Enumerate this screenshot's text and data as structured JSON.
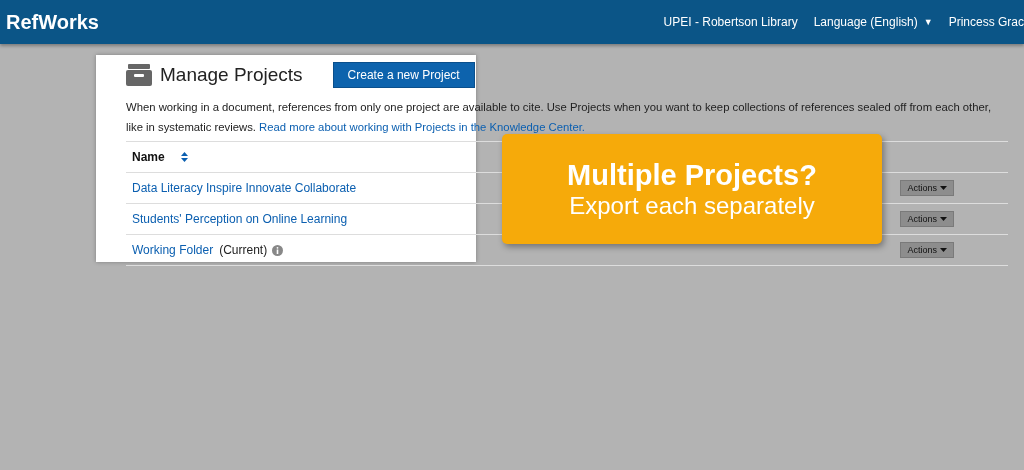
{
  "header": {
    "logo": "RefWorks",
    "institution": "UPEI - Robertson Library",
    "language": "Language (English)",
    "language_caret": "▼",
    "user": "Princess Grac"
  },
  "page": {
    "title": "Manage Projects",
    "create_button": "Create a new Project",
    "description": "When working in a document, references from only one project are available to cite. Use Projects when you want to keep collections of references sealed off from each other, like in systematic reviews.",
    "link": "Read more about working with Projects in the Knowledge Center."
  },
  "table": {
    "columns": [
      {
        "label": "Name"
      }
    ],
    "rows": [
      {
        "name": "Data Literacy Inspire Innovate Collaborate",
        "action": "Actions"
      },
      {
        "name": "Students' Perception on Online Learning",
        "action": "Actions"
      },
      {
        "name": "Working Folder",
        "status": "(Current)",
        "action": "Actions"
      }
    ]
  },
  "callout": {
    "title": "Multiple Projects?",
    "subtitle": "Export each separately"
  }
}
